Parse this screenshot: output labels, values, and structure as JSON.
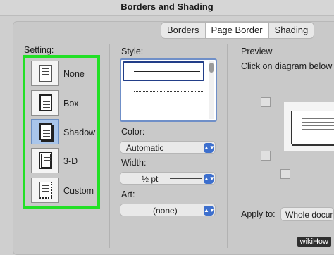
{
  "window": {
    "title": "Borders and Shading"
  },
  "tabs": [
    {
      "label": "Borders",
      "active": false
    },
    {
      "label": "Page Border",
      "active": true
    },
    {
      "label": "Shading",
      "active": false
    }
  ],
  "setting": {
    "label": "Setting:",
    "options": [
      {
        "label": "None",
        "icon": "page-none-icon",
        "selected": false
      },
      {
        "label": "Box",
        "icon": "page-box-icon",
        "selected": false
      },
      {
        "label": "Shadow",
        "icon": "page-shadow-icon",
        "selected": true
      },
      {
        "label": "3-D",
        "icon": "page-3d-icon",
        "selected": false
      },
      {
        "label": "Custom",
        "icon": "page-custom-icon",
        "selected": false
      }
    ],
    "highlight_color": "#22e026"
  },
  "style": {
    "label": "Style:"
  },
  "color": {
    "label": "Color:",
    "value": "Automatic"
  },
  "width": {
    "label": "Width:",
    "value": "½ pt"
  },
  "art": {
    "label": "Art:",
    "value": "(none)"
  },
  "preview": {
    "label": "Preview",
    "instruction": "Click on diagram below o",
    "apply_label": "Apply to:",
    "apply_value": "Whole docum"
  },
  "watermark": {
    "text": "wikiHow"
  },
  "colors": {
    "accent": "#3d6fcd",
    "selection": "#a9c5ea"
  }
}
